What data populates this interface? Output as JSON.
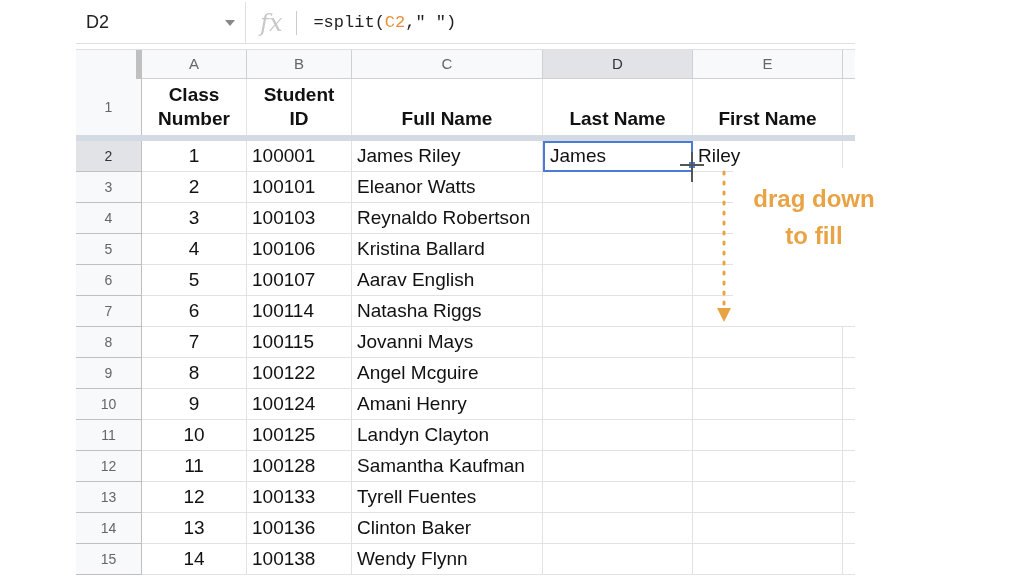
{
  "name_box": "D2",
  "formula_parts": [
    {
      "kind": "text",
      "text": "=split("
    },
    {
      "kind": "ref",
      "text": "C2"
    },
    {
      "kind": "text",
      "text": ",\" \")"
    }
  ],
  "fx_label": "fx",
  "columns": [
    {
      "label": "A",
      "selected": false
    },
    {
      "label": "B",
      "selected": false
    },
    {
      "label": "C",
      "selected": false
    },
    {
      "label": "D",
      "selected": true
    },
    {
      "label": "E",
      "selected": false
    }
  ],
  "header_row": {
    "number": "1",
    "cells": [
      "Class Number",
      "Student ID",
      "Full Name",
      "Last Name",
      "First Name"
    ]
  },
  "rows": [
    {
      "number": "2",
      "selected": true,
      "cells": [
        "1",
        "100001",
        "James Riley",
        "James",
        "Riley"
      ]
    },
    {
      "number": "3",
      "selected": false,
      "cells": [
        "2",
        "100101",
        "Eleanor Watts"
      ]
    },
    {
      "number": "4",
      "selected": false,
      "cells": [
        "3",
        "100103",
        "Reynaldo Robertson"
      ]
    },
    {
      "number": "5",
      "selected": false,
      "cells": [
        "4",
        "100106",
        "Kristina Ballard"
      ]
    },
    {
      "number": "6",
      "selected": false,
      "cells": [
        "5",
        "100107",
        "Aarav English"
      ]
    },
    {
      "number": "7",
      "selected": false,
      "cells": [
        "6",
        "100114",
        "Natasha Riggs"
      ]
    },
    {
      "number": "8",
      "selected": false,
      "cells": [
        "7",
        "100115",
        "Jovanni Mays"
      ]
    },
    {
      "number": "9",
      "selected": false,
      "cells": [
        "8",
        "100122",
        "Angel Mcguire"
      ]
    },
    {
      "number": "10",
      "selected": false,
      "cells": [
        "9",
        "100124",
        "Amani Henry"
      ]
    },
    {
      "number": "11",
      "selected": false,
      "cells": [
        "10",
        "100125",
        "Landyn Clayton"
      ]
    },
    {
      "number": "12",
      "selected": false,
      "cells": [
        "11",
        "100128",
        "Samantha Kaufman"
      ]
    },
    {
      "number": "13",
      "selected": false,
      "cells": [
        "12",
        "100133",
        "Tyrell Fuentes"
      ]
    },
    {
      "number": "14",
      "selected": false,
      "cells": [
        "13",
        "100136",
        "Clinton Baker"
      ]
    },
    {
      "number": "15",
      "selected": false,
      "cells": [
        "14",
        "100138",
        "Wendy Flynn"
      ]
    }
  ],
  "annotation": "drag down to fill"
}
